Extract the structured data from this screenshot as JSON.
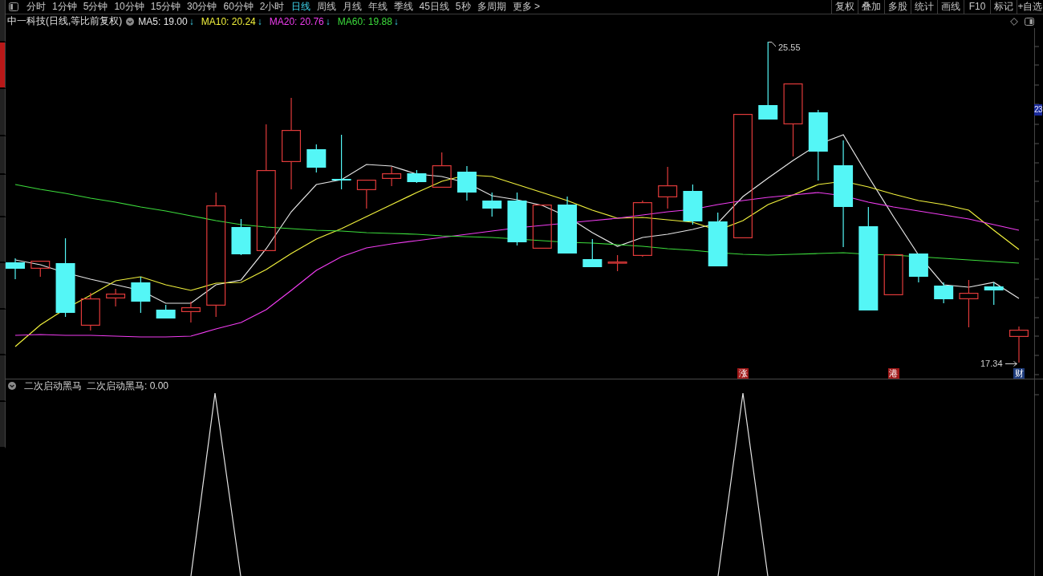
{
  "toolbar": {
    "periods": [
      {
        "label": "分时",
        "selected": false
      },
      {
        "label": "1分钟",
        "selected": false
      },
      {
        "label": "5分钟",
        "selected": false
      },
      {
        "label": "10分钟",
        "selected": false
      },
      {
        "label": "15分钟",
        "selected": false
      },
      {
        "label": "30分钟",
        "selected": false
      },
      {
        "label": "60分钟",
        "selected": false
      },
      {
        "label": "2小时",
        "selected": false
      },
      {
        "label": "日线",
        "selected": true
      },
      {
        "label": "周线",
        "selected": false
      },
      {
        "label": "月线",
        "selected": false
      },
      {
        "label": "年线",
        "selected": false
      },
      {
        "label": "季线",
        "selected": false
      },
      {
        "label": "45日线",
        "selected": false
      },
      {
        "label": "5秒",
        "selected": false
      },
      {
        "label": "多周期",
        "selected": false
      },
      {
        "label": "更多 >",
        "selected": false
      }
    ],
    "actions": [
      "复权",
      "叠加",
      "多股",
      "统计",
      "画线",
      "F10",
      "标记",
      "+自选"
    ]
  },
  "side_tabs": [
    {
      "selected": false
    },
    {
      "selected": true
    },
    {
      "selected": false
    },
    {
      "selected": false
    },
    {
      "selected": false
    },
    {
      "selected": false
    },
    {
      "selected": false
    },
    {
      "selected": false
    },
    {
      "selected": false
    },
    {
      "selected": false
    }
  ],
  "chart_header": {
    "title": "中一科技(日线,等比前复权)",
    "moving_averages": [
      {
        "label": "MA5: 19.00",
        "arrow": "↓",
        "color": "#e6e6e6"
      },
      {
        "label": "MA10: 20.24",
        "arrow": "↓",
        "color": "#f0f03c"
      },
      {
        "label": "MA20: 20.76",
        "arrow": "↓",
        "color": "#f03cf0"
      },
      {
        "label": "MA60: 19.88",
        "arrow": "↓",
        "color": "#3cdc3c"
      }
    ]
  },
  "price_chart": {
    "high_label": "25.55",
    "low_label": "17.34",
    "axis_label": "23",
    "markers": [
      {
        "text": "涨",
        "color": "#a01818"
      },
      {
        "text": "港",
        "color": "#a01818"
      },
      {
        "text": "财",
        "color": "#1e3c7c"
      }
    ]
  },
  "indicator": {
    "name": "二次启动黑马",
    "reading": "二次启动黑马: 0.00"
  }
}
